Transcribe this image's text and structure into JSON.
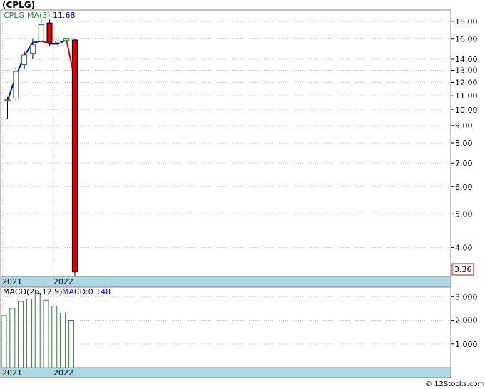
{
  "title": "(CPLG)",
  "copyright": "© 12Stocks.com",
  "chart_data": [
    {
      "type": "candlestick",
      "ticker_label": "CPLG",
      "ma_label": "MA(3)",
      "ma_value_label": "11.68",
      "last_price_label": "3.36",
      "y_scale": "log",
      "ylim": [
        3.3,
        19.4
      ],
      "y_ticks": [
        "18.00",
        "16.00",
        "14.00",
        "13.00",
        "12.00",
        "11.00",
        "10.00",
        "9.00",
        "8.00",
        "7.00",
        "6.00",
        "5.00",
        "4.00"
      ],
      "x_ticks": [
        "2021",
        "2022"
      ],
      "grid": true,
      "candles": [
        {
          "o": 10.6,
          "h": 10.9,
          "l": 9.4,
          "c": 10.7
        },
        {
          "o": 10.8,
          "h": 13.3,
          "l": 10.6,
          "c": 12.9
        },
        {
          "o": 13.5,
          "h": 14.8,
          "l": 13.1,
          "c": 14.4
        },
        {
          "o": 14.5,
          "h": 16.0,
          "l": 14.0,
          "c": 15.4
        },
        {
          "o": 15.8,
          "h": 18.3,
          "l": 15.6,
          "c": 17.6
        },
        {
          "o": 17.8,
          "h": 18.2,
          "l": 15.3,
          "c": 15.6
        },
        {
          "o": 15.6,
          "h": 15.9,
          "l": 15.2,
          "c": 15.8
        },
        {
          "o": 15.9,
          "h": 16.1,
          "l": 15.8,
          "c": 16.0
        },
        {
          "o": 15.9,
          "h": 16.0,
          "l": 3.3,
          "c": 3.4
        }
      ],
      "ma": [
        10.6,
        12.5,
        14.3,
        15.6,
        15.8,
        15.5,
        15.5,
        15.9,
        12.2
      ],
      "colors": {
        "up": "#2e7d32",
        "down": "#e00000",
        "ma_up": "#0000cc",
        "ma_down": "#e00000",
        "axis_band": "#add8e6",
        "grid": "#c8c8c8"
      }
    },
    {
      "type": "bar",
      "label": "MACD(26,12,9)",
      "value_label": "MACD:0.148",
      "ylim": [
        0.0,
        3.4
      ],
      "y_ticks": [
        "3.000",
        "2.000",
        "1.000"
      ],
      "x_ticks": [
        "2021",
        "2022"
      ],
      "values": [
        2.2,
        2.5,
        2.8,
        2.9,
        3.15,
        2.85,
        2.6,
        2.3,
        2.0
      ],
      "colors": {
        "bar": "#2e7d32"
      }
    }
  ]
}
